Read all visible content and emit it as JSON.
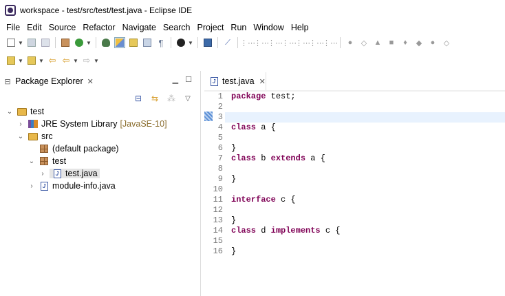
{
  "window": {
    "title": "workspace - test/src/test/test.java - Eclipse IDE"
  },
  "menu": [
    "File",
    "Edit",
    "Source",
    "Refactor",
    "Navigate",
    "Search",
    "Project",
    "Run",
    "Window",
    "Help"
  ],
  "package_explorer": {
    "tab_label": "Package Explorer",
    "tree": {
      "project": "test",
      "jre": "JRE System Library",
      "jre_version": "[JavaSE-10]",
      "src": "src",
      "default_package": "(default package)",
      "pkg_test": "test",
      "file_test": "test.java",
      "module_info": "module-info.java"
    }
  },
  "editor": {
    "tab_label": "test.java",
    "line_numbers": [
      "1",
      "2",
      "3",
      "4",
      "5",
      "6",
      "7",
      "8",
      "9",
      "10",
      "11",
      "12",
      "13",
      "14",
      "15",
      "16"
    ],
    "lines": {
      "l1_kw": "package",
      "l1_rest": " test;",
      "l4_kw": "class",
      "l4_rest": " a {",
      "l6": "}",
      "l7_kw": "class",
      "l7_mid": " b ",
      "l7_kw2": "extends",
      "l7_rest": " a {",
      "l9": "}",
      "l11_kw": "interface",
      "l11_rest": " c {",
      "l13": "}",
      "l14_kw": "class",
      "l14_mid": " d ",
      "l14_kw2": "implements",
      "l14_rest": " c {",
      "l16": "}"
    }
  },
  "colors": {
    "keyword": "#7f0055",
    "current_line": "#e8f2fe"
  }
}
